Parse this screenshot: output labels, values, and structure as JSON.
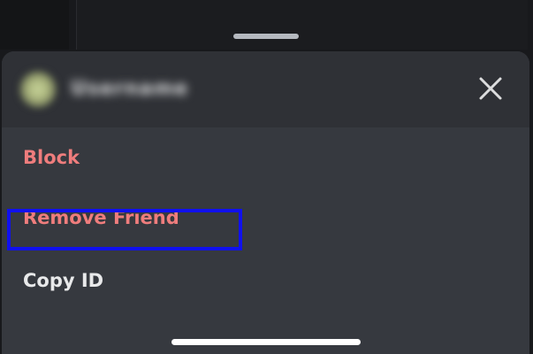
{
  "header": {
    "username": "Username",
    "close_icon": "close-icon"
  },
  "menu": {
    "items": [
      {
        "label": "Block",
        "kind": "danger"
      },
      {
        "label": "Remove Friend",
        "kind": "danger"
      },
      {
        "label": "Copy ID",
        "kind": "normal",
        "highlighted": true
      }
    ]
  },
  "colors": {
    "danger": "#ef7d7d",
    "normal": "#e8e9ea",
    "sheet_background": "#36393f",
    "header_background": "#2f3136",
    "highlight_border": "#1010ee"
  }
}
